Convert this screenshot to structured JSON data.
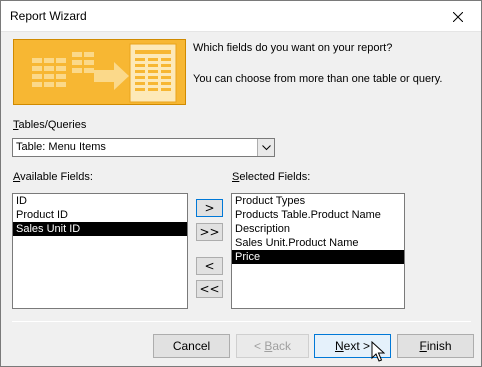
{
  "window": {
    "title": "Report Wizard"
  },
  "icons": {
    "close": "close-icon",
    "banner": "report-wizard-illustration",
    "combo_arrow": "chevron-down-icon",
    "cursor": "mouse-pointer"
  },
  "header": {
    "question": "Which fields do you want on your report?",
    "hint": "You can choose from more than one table or query."
  },
  "tables": {
    "label_key": "T",
    "label_rest": "ables/Queries",
    "selected": "Table: Menu Items"
  },
  "available": {
    "label_key": "A",
    "label_rest": "vailable Fields:",
    "items": [
      "ID",
      "Product ID",
      "Sales Unit ID"
    ],
    "selected_index": 2
  },
  "selected_fields": {
    "label_key": "S",
    "label_rest": "elected Fields:",
    "items": [
      "Product Types",
      "Products Table.Product Name",
      "Description",
      "Sales Unit.Product Name",
      "Price"
    ],
    "selected_index": 4
  },
  "move_buttons": {
    "add_one": ">",
    "add_all": ">>",
    "remove_one": "<",
    "remove_all": "<<"
  },
  "footer": {
    "cancel": "Cancel",
    "back_prefix": "< ",
    "back_key": "B",
    "back_rest": "ack",
    "next_key": "N",
    "next_rest": "ext >",
    "finish_key": "F",
    "finish_rest": "inish"
  },
  "colors": {
    "banner": "#f7b733",
    "focus": "#0078d7",
    "selection": "#000000"
  }
}
